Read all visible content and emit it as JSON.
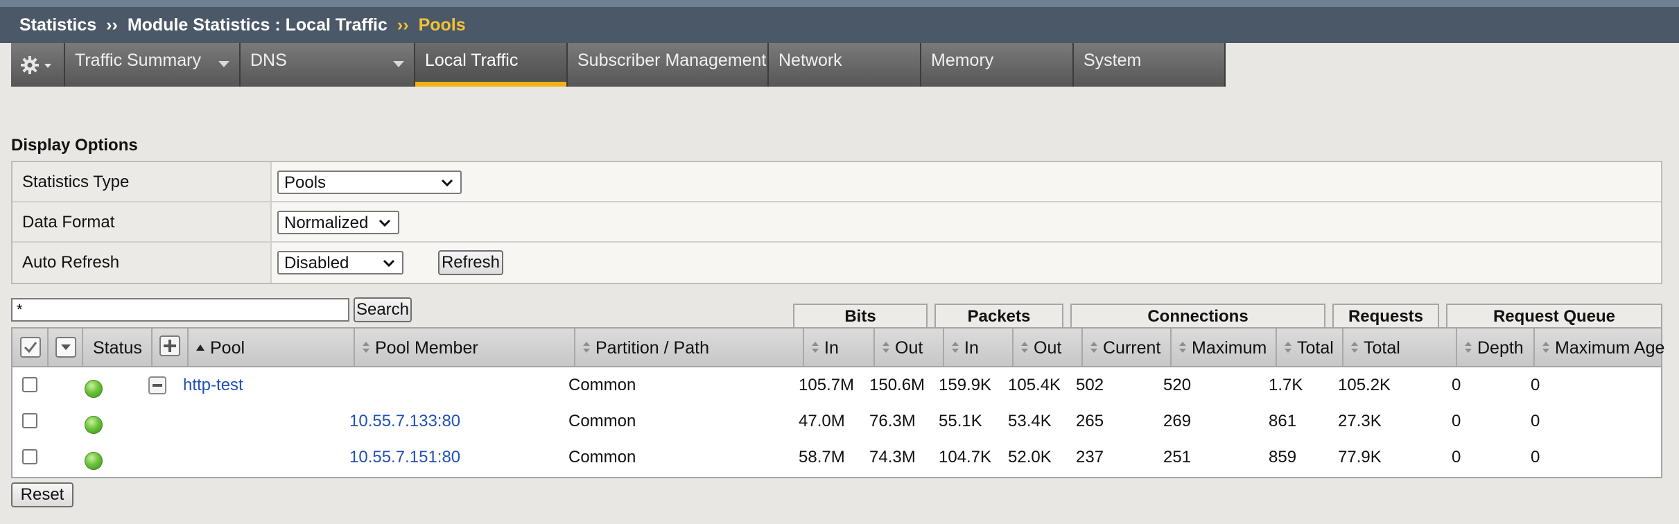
{
  "breadcrumb": {
    "root": "Statistics",
    "section": "Module Statistics : Local Traffic",
    "current": "Pools",
    "separator": "››"
  },
  "tabs": [
    {
      "label": "Traffic Summary",
      "has_dropdown": true
    },
    {
      "label": "DNS",
      "has_dropdown": true
    },
    {
      "label": "Local Traffic",
      "active": true
    },
    {
      "label": "Subscriber Management"
    },
    {
      "label": "Network"
    },
    {
      "label": "Memory"
    },
    {
      "label": "System"
    }
  ],
  "display_options": {
    "title": "Display Options",
    "statistics_type": {
      "label": "Statistics Type",
      "value": "Pools"
    },
    "data_format": {
      "label": "Data Format",
      "value": "Normalized"
    },
    "auto_refresh": {
      "label": "Auto Refresh",
      "value": "Disabled",
      "refresh_button": "Refresh"
    }
  },
  "search": {
    "value": "*",
    "button": "Search"
  },
  "groups": {
    "bits": "Bits",
    "packets": "Packets",
    "connections": "Connections",
    "requests": "Requests",
    "request_queue": "Request Queue"
  },
  "columns": {
    "status": "Status",
    "pool": "Pool",
    "pool_member": "Pool Member",
    "partition": "Partition / Path",
    "bits_in": "In",
    "bits_out": "Out",
    "packets_in": "In",
    "packets_out": "Out",
    "conn_current": "Current",
    "conn_maximum": "Maximum",
    "conn_total": "Total",
    "req_total": "Total",
    "queue_depth": "Depth",
    "queue_max_age": "Maximum Age"
  },
  "rows": [
    {
      "pool": "http-test",
      "member": "",
      "partition": "Common",
      "bits_in": "105.7M",
      "bits_out": "150.6M",
      "packets_in": "159.9K",
      "packets_out": "105.4K",
      "conn_current": "502",
      "conn_maximum": "520",
      "conn_total": "1.7K",
      "req_total": "105.2K",
      "queue_depth": "0",
      "queue_max_age": "0",
      "status": "available"
    },
    {
      "pool": "",
      "member": "10.55.7.133:80",
      "partition": "Common",
      "bits_in": "47.0M",
      "bits_out": "76.3M",
      "packets_in": "55.1K",
      "packets_out": "53.4K",
      "conn_current": "265",
      "conn_maximum": "269",
      "conn_total": "861",
      "req_total": "27.3K",
      "queue_depth": "0",
      "queue_max_age": "0",
      "status": "available"
    },
    {
      "pool": "",
      "member": "10.55.7.151:80",
      "partition": "Common",
      "bits_in": "58.7M",
      "bits_out": "74.3M",
      "packets_in": "104.7K",
      "packets_out": "52.0K",
      "conn_current": "237",
      "conn_maximum": "251",
      "conn_total": "859",
      "req_total": "77.9K",
      "queue_depth": "0",
      "queue_max_age": "0",
      "status": "available"
    }
  ],
  "reset_button": "Reset",
  "colors": {
    "accent": "#f0b21b",
    "link": "#2150b5",
    "status_ok": "#6cc43c"
  }
}
